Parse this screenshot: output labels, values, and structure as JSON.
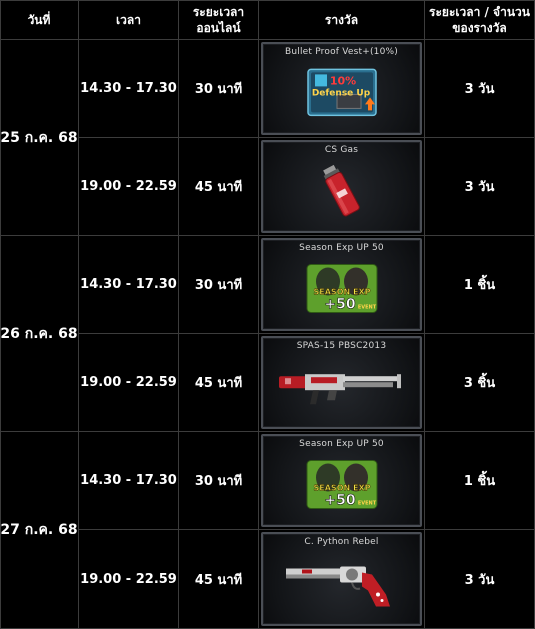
{
  "header": {
    "date": "วันที่",
    "time": "เวลา",
    "online": "ระยะเวลา\nออนไลน์",
    "reward": "รางวัล",
    "duration": "ระยะเวลา / จำนวน\nของรางวัล"
  },
  "days": [
    {
      "date": "25 ก.ค. 68",
      "slots": [
        {
          "time": "14.30 - 17.30",
          "online": "30 นาที",
          "reward_name": "Bullet Proof Vest+(10%)",
          "reward_icon": "defense-up-icon",
          "reward_badge": "10%",
          "reward_badge_text": "Defense Up",
          "amount": "3 วัน"
        },
        {
          "time": "19.00 - 22.59",
          "online": "45 นาที",
          "reward_name": "CS Gas",
          "reward_icon": "gas-grenade-icon",
          "amount": "3 วัน"
        }
      ]
    },
    {
      "date": "26 ก.ค. 68",
      "slots": [
        {
          "time": "14.30 - 17.30",
          "online": "30 นาที",
          "reward_name": "Season Exp UP 50",
          "reward_icon": "season-exp-icon",
          "reward_badge": "SEASON EXP",
          "reward_badge_text": "+50",
          "reward_badge_event": "EVENT",
          "amount": "1 ชิ้น"
        },
        {
          "time": "19.00 - 22.59",
          "online": "45 นาที",
          "reward_name": "SPAS-15 PBSC2013",
          "reward_icon": "shotgun-icon",
          "amount": "3 ชิ้น"
        }
      ]
    },
    {
      "date": "27 ก.ค. 68",
      "slots": [
        {
          "time": "14.30 - 17.30",
          "online": "30 นาที",
          "reward_name": "Season Exp UP 50",
          "reward_icon": "season-exp-icon",
          "reward_badge": "SEASON EXP",
          "reward_badge_text": "+50",
          "reward_badge_event": "EVENT",
          "amount": "1 ชิ้น"
        },
        {
          "time": "19.00 - 22.59",
          "online": "45 นาที",
          "reward_name": "C. Python Rebel",
          "reward_icon": "revolver-icon",
          "amount": "3 วัน"
        }
      ]
    }
  ],
  "colors": {
    "background": "#000000",
    "border": "#3c3c3c",
    "card_border": "#4a4e55",
    "text": "#ffffff"
  }
}
